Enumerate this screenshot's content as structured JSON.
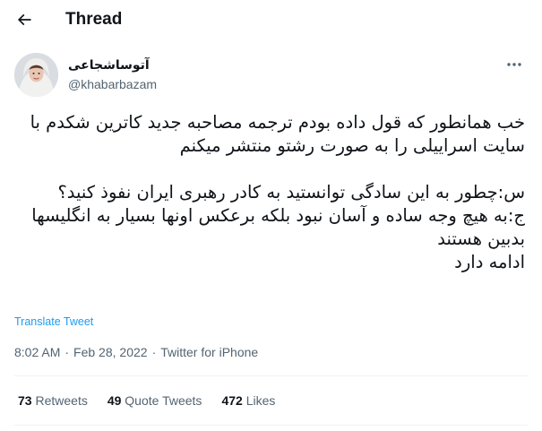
{
  "header": {
    "title": "Thread"
  },
  "tweet": {
    "author_name": "آتوساشجاعی",
    "author_handle": "@khabarbazam",
    "text": "خب همانطور که قول داده بودم ترجمه مصاحبه جدید کاترین شکدم با سایت اسراییلی را به صورت رشتو منتشر میکنم\n\nس:چطور به این سادگی توانستید به کادر رهبری ایران نفوذ کنید؟\nج:به هیچ وجه ساده و آسان نبود بلکه برعکس اونها بسیار به انگلیسها بدبین هستند\nادامه دارد",
    "translate_label": "Translate Tweet",
    "time": "8:02 AM",
    "date": "Feb 28, 2022",
    "source": "Twitter for iPhone",
    "separator": "·"
  },
  "stats": {
    "retweets_count": "73",
    "retweets_label": "Retweets",
    "quotes_count": "49",
    "quotes_label": "Quote Tweets",
    "likes_count": "472",
    "likes_label": "Likes"
  },
  "icons": {
    "back": "arrow-left-icon",
    "more": "more-horizontal-icon"
  },
  "colors": {
    "text": "#0f1419",
    "secondary": "#536471",
    "link": "#1d9bf0",
    "divider": "#eff3f4"
  }
}
